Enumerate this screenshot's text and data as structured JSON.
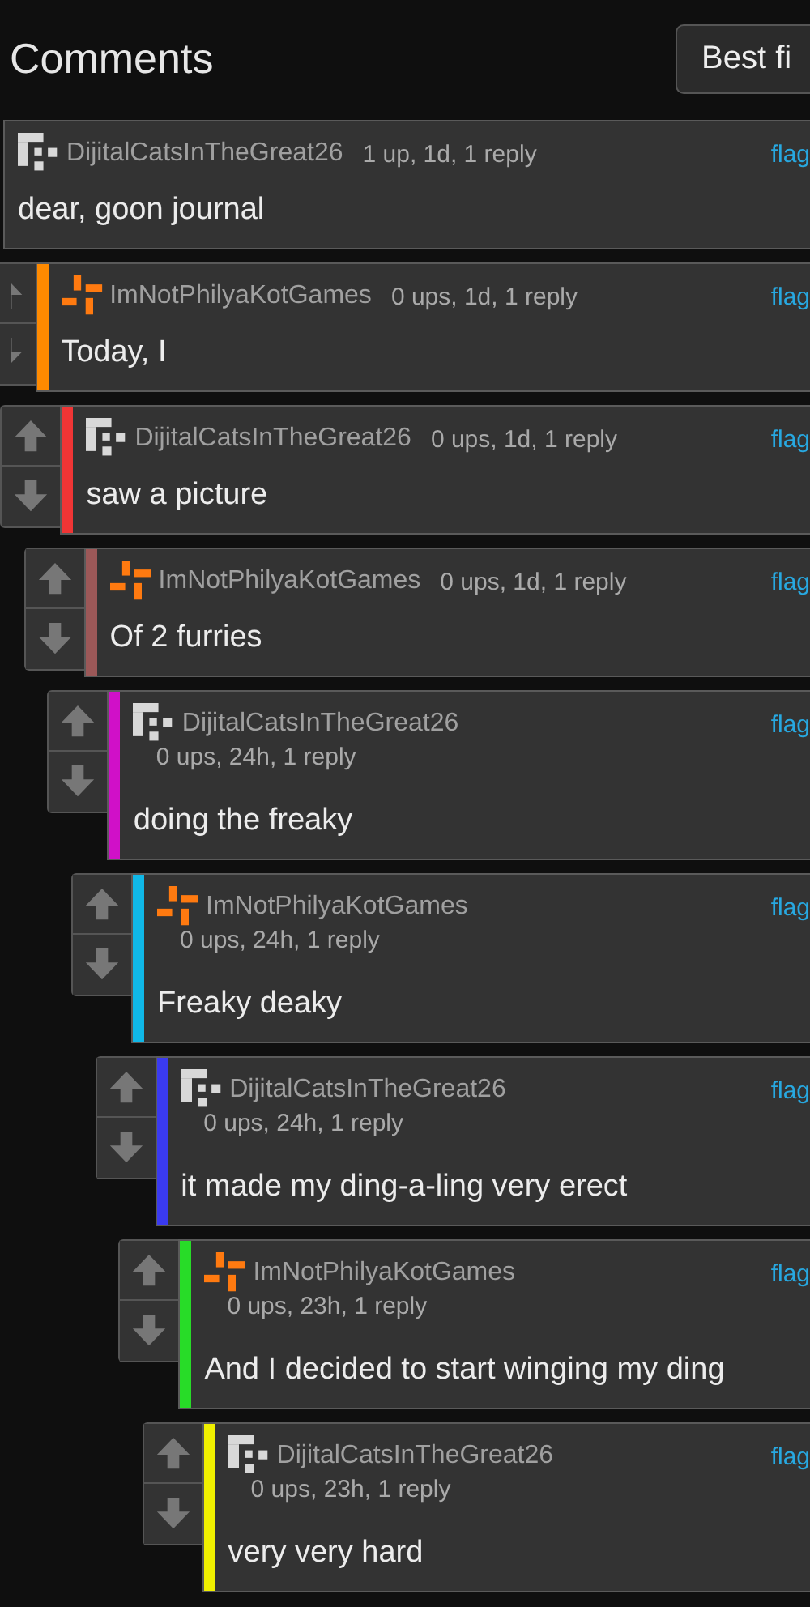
{
  "header": {
    "title": "Comments",
    "sort_button": "Best fi"
  },
  "comments": [
    {
      "user": "DijitalCatsInTheGreat26",
      "kind": "blocks",
      "meta": "1 up, 1d, 1 reply",
      "flag": "flag",
      "text": "dear, goon journal",
      "children": [
        {
          "user": "ImNotPhilyaKotGames",
          "kind": "cross",
          "color": "#ff8a00",
          "meta": "0 ups, 1d, 1 reply",
          "flag": "flag",
          "text": "Today, I",
          "children": [
            {
              "user": "DijitalCatsInTheGreat26",
              "kind": "blocks",
              "color": "#f03535",
              "meta": "0 ups, 1d, 1 reply",
              "flag": "flag",
              "text": "saw a picture",
              "children": [
                {
                  "user": "ImNotPhilyaKotGames",
                  "kind": "cross",
                  "color": "#9c5858",
                  "meta": "0 ups, 1d, 1 reply",
                  "flag": "flag",
                  "text": "Of 2 furries",
                  "children": [
                    {
                      "user": "DijitalCatsInTheGreat26",
                      "kind": "blocks",
                      "color": "#d010c8",
                      "meta": "0 ups, 24h, 1 reply",
                      "flag": "flag",
                      "text": "doing the freaky",
                      "children": [
                        {
                          "user": "ImNotPhilyaKotGames",
                          "kind": "cross",
                          "color": "#10b8e8",
                          "meta": "0 ups, 24h, 1 reply",
                          "flag": "flag",
                          "text": "Freaky deaky",
                          "children": [
                            {
                              "user": "DijitalCatsInTheGreat26",
                              "kind": "blocks",
                              "color": "#3a3af0",
                              "meta": "0 ups, 24h, 1 reply",
                              "flag": "flag",
                              "text": "it made my ding-a-ling very erect",
                              "children": [
                                {
                                  "user": "ImNotPhilyaKotGames",
                                  "kind": "cross",
                                  "color": "#28dc28",
                                  "meta": "0 ups, 23h, 1 reply",
                                  "flag": "flag",
                                  "text": "And I decided to start winging my ding",
                                  "children": [
                                    {
                                      "user": "DijitalCatsInTheGreat26",
                                      "kind": "blocks",
                                      "color": "#f0f000",
                                      "meta": "0 ups, 23h, 1 reply",
                                      "flag": "flag",
                                      "text": "very very hard"
                                    }
                                  ]
                                }
                              ]
                            }
                          ]
                        }
                      ]
                    }
                  ]
                }
              ]
            }
          ]
        }
      ]
    }
  ]
}
